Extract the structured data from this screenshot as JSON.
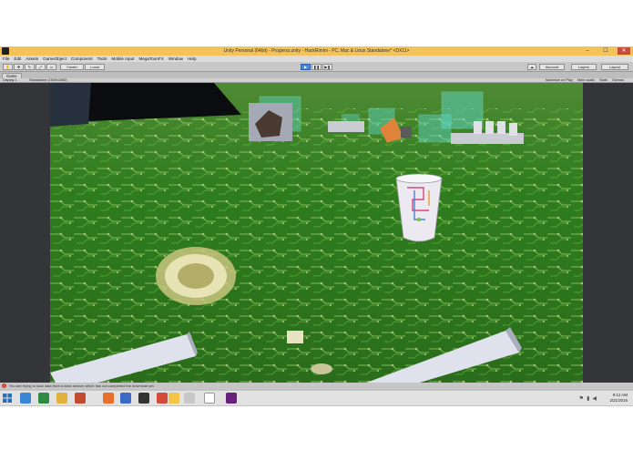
{
  "window": {
    "title": "Unity Personal (64bit) - Progress.unity - HackRimini - PC, Mac & Linux Standalone* <DX11>",
    "controls": [
      "–",
      "☐",
      "✕"
    ]
  },
  "menu": [
    "File",
    "Edit",
    "Assets",
    "GameObject",
    "Component",
    "Tools",
    "Mobile Input",
    "MegaToonFX",
    "Window",
    "Help"
  ],
  "toolbar": {
    "pivot_label": "Center",
    "space_label": "Local",
    "account_label": "Account",
    "layers_label": "Layers",
    "layout_label": "Layout"
  },
  "game_view": {
    "tab_label": "Game",
    "display_label": "Display 1",
    "resolution_label": "Standalone (1920x1080)",
    "toggles": [
      "Maximize on Play",
      "Mute audio",
      "Stats",
      "Gizmos"
    ]
  },
  "status": {
    "message": "You are trying to load data from a www stream which has not completed the download yet."
  },
  "taskbar": {
    "time": "9:12 AM",
    "date": "2/21/2016"
  },
  "colors": {
    "title_bar": "#f3c35a",
    "play_accent": "#4c84d6",
    "circuit_green": "#2f7d1e",
    "warning": "#d63a2c"
  }
}
